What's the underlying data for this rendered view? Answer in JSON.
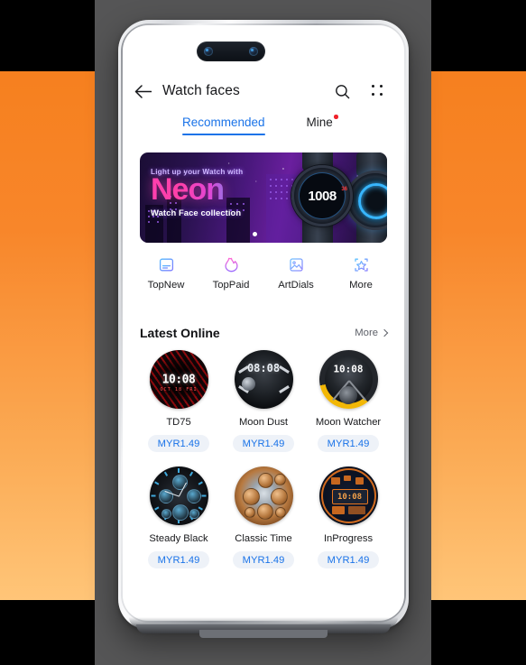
{
  "background": {
    "top_bar_color": "#000000",
    "bottom_bar_color": "#000000",
    "orange_gradient_from": "#f6801f",
    "orange_gradient_to": "#ffc578",
    "panel_color": "#555556"
  },
  "device": {
    "camera": "dual-punch-hole-camera"
  },
  "header": {
    "back_icon": "back-arrow-icon",
    "title": "Watch faces",
    "search_icon": "search-icon",
    "menu_icon": "grid-menu-icon"
  },
  "tabs": [
    {
      "label": "Recommended",
      "active": true,
      "badge": false
    },
    {
      "label": "Mine",
      "active": false,
      "badge": true
    }
  ],
  "banner": {
    "tagline": "Light up your Watch with",
    "headline": "Neon",
    "subtitle": "Watch Face collection",
    "watch_time_hours": "10",
    "watch_time_minutes": "08",
    "watch_badge": "36",
    "carousel_dots": 1,
    "active_dot": 0
  },
  "categories": [
    {
      "label": "TopNew",
      "icon": "new-card-icon"
    },
    {
      "label": "TopPaid",
      "icon": "flame-icon"
    },
    {
      "label": "ArtDials",
      "icon": "picture-icon"
    },
    {
      "label": "More",
      "icon": "star-frame-icon"
    }
  ],
  "section": {
    "title": "Latest Online",
    "more_label": "More",
    "more_icon": "chevron-right-icon"
  },
  "faces": [
    {
      "name": "TD75",
      "price": "MYR1.49",
      "art": "t-td75",
      "time": "10:08",
      "date": "OCT 18  FRI"
    },
    {
      "name": "Moon Dust",
      "price": "MYR1.49",
      "art": "t-moondust",
      "time": "08:08",
      "date": ""
    },
    {
      "name": "Moon Watcher",
      "price": "MYR1.49",
      "art": "t-moonwatch",
      "time": "10:08",
      "date": ""
    },
    {
      "name": "Steady Black",
      "price": "MYR1.49",
      "art": "t-steady",
      "time": "",
      "date": ""
    },
    {
      "name": "Classic Time",
      "price": "MYR1.49",
      "art": "t-classic",
      "time": "",
      "date": ""
    },
    {
      "name": "InProgress",
      "price": "MYR1.49",
      "art": "t-inprog",
      "time": "10:08",
      "date": ""
    }
  ],
  "colors": {
    "accent_blue": "#1a73e8",
    "price_pill_bg": "#eef2f8",
    "badge_red": "#f0222a"
  }
}
